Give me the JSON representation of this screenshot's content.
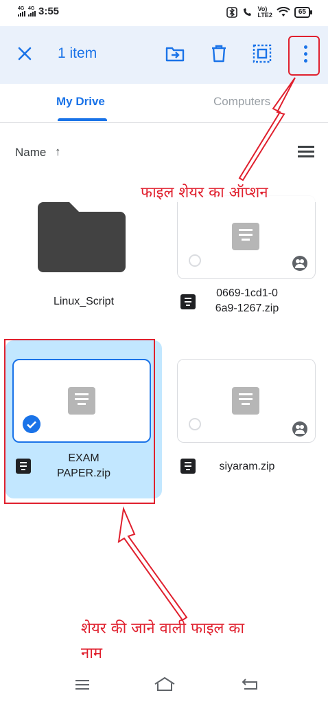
{
  "status_bar": {
    "net1": "4G",
    "net2": "4G",
    "time": "3:55",
    "volte_top": "Vo)",
    "volte_bottom": "LTE2",
    "battery": "65"
  },
  "app_bar": {
    "count": "1 item"
  },
  "tabs": [
    {
      "label": "My Drive",
      "active": true
    },
    {
      "label": "Computers",
      "active": false
    }
  ],
  "sort": {
    "label": "Name",
    "arrow": "↑"
  },
  "files": [
    {
      "name": "Linux_Script",
      "type": "folder"
    },
    {
      "name_line1": "0669-1cd1-0",
      "name_line2": "6a9-1267.zip",
      "type": "zip",
      "shared": true
    },
    {
      "name_line1": "EXAM",
      "name_line2": "PAPER.zip",
      "type": "zip",
      "selected": true
    },
    {
      "name": "siyaram.zip",
      "type": "zip",
      "shared": true
    }
  ],
  "annotations": {
    "share_option": "फाइल शेयर का ऑप्शन",
    "file_name_line1": "शेयर की जाने वाली फाइल का",
    "file_name_line2": "नाम"
  },
  "colors": {
    "accent": "#1a73e8",
    "annotation": "#e0202e",
    "selected_bg": "#c2e7ff",
    "appbar_bg": "#eaf1fb"
  }
}
